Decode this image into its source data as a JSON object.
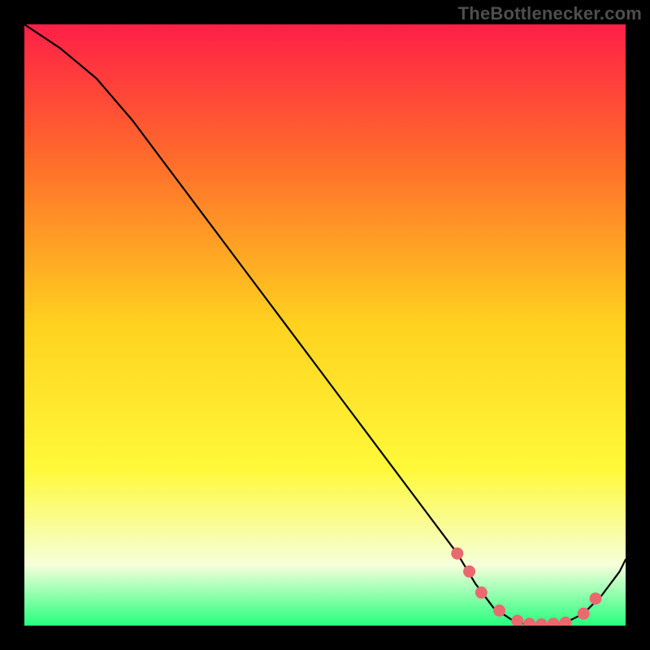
{
  "watermark": "TheBottlenecker.com",
  "colors": {
    "bg": "#000000",
    "grad_top": "#ff1f47",
    "grad_mid_upper": "#ff6a2b",
    "grad_mid": "#ffd21f",
    "grad_mid_lower": "#fff93a",
    "grad_low": "#f5ffda",
    "grad_bottom": "#26ff7e",
    "curve": "#000000",
    "marker": "#e86a6f"
  },
  "chart_data": {
    "type": "line",
    "title": "",
    "xlabel": "",
    "ylabel": "",
    "xlim": [
      0,
      100
    ],
    "ylim": [
      0,
      100
    ],
    "series": [
      {
        "name": "bottleneck-curve",
        "x": [
          0,
          6,
          12,
          18,
          24,
          30,
          36,
          42,
          48,
          54,
          60,
          66,
          72,
          75,
          78,
          81,
          84,
          87,
          90,
          93,
          96,
          99,
          100
        ],
        "y": [
          100,
          96,
          91,
          84,
          76,
          68,
          60,
          52,
          44,
          36,
          28,
          20,
          12,
          7,
          3,
          1,
          0,
          0,
          0.5,
          2,
          5,
          9,
          11
        ]
      }
    ],
    "markers": {
      "name": "highlight-points",
      "x": [
        72,
        74,
        76,
        79,
        82,
        84,
        86,
        88,
        90,
        93,
        95
      ],
      "y": [
        12,
        9,
        5.5,
        2.5,
        0.8,
        0.3,
        0.2,
        0.3,
        0.5,
        2,
        4.5
      ]
    }
  }
}
